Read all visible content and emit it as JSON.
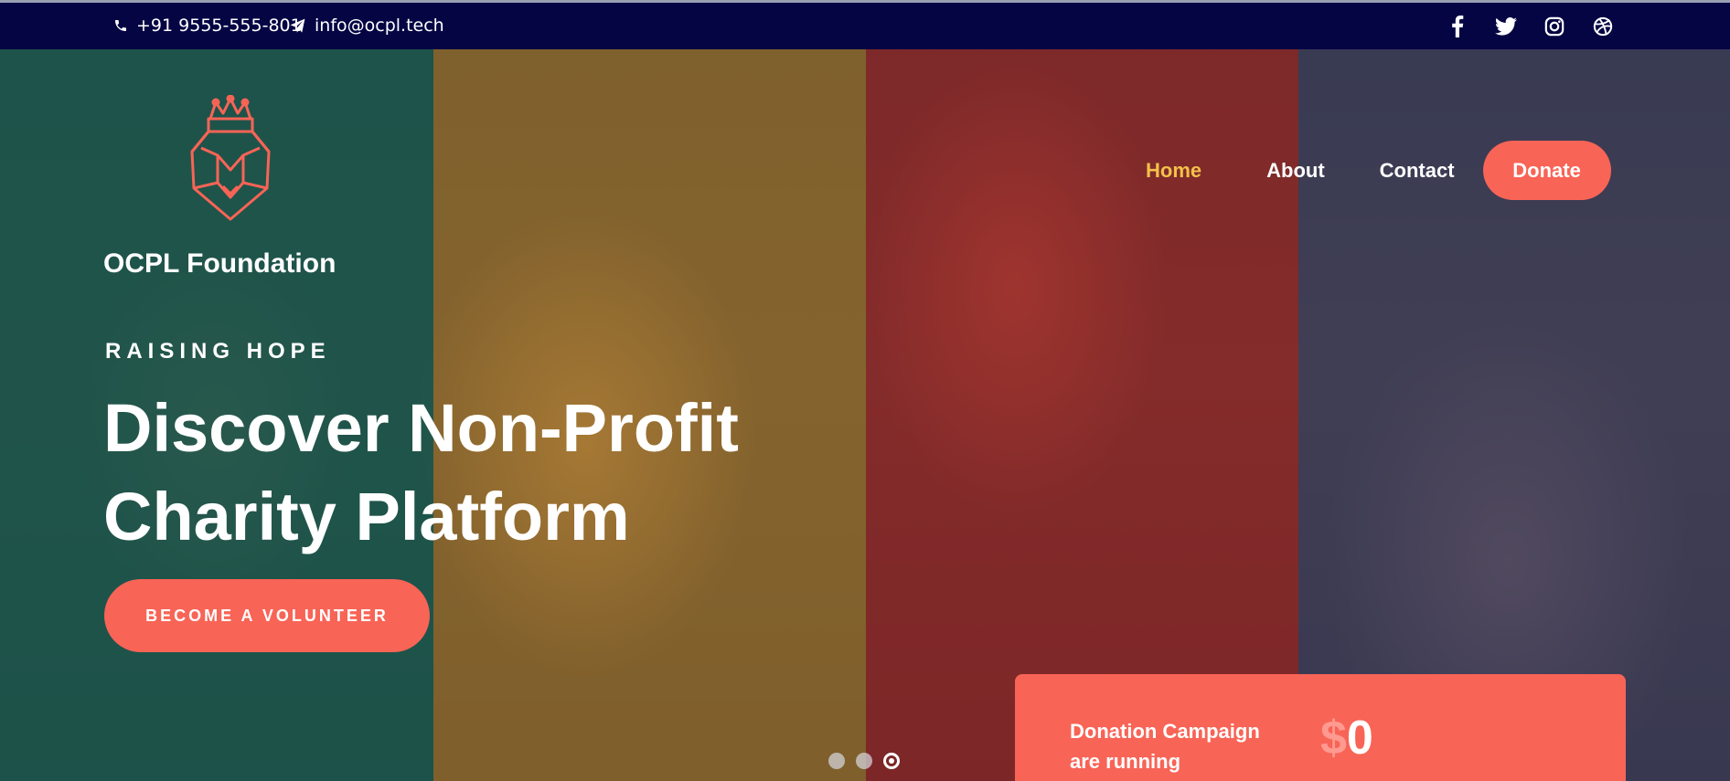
{
  "topbar": {
    "phone": "+91 9555-555-801",
    "email": "info@ocpl.tech",
    "socials": [
      "facebook-icon",
      "twitter-icon",
      "instagram-icon",
      "dribbble-icon"
    ]
  },
  "brand": {
    "name": "OCPL Foundation",
    "logo_icon": "crowned-lion-shield-icon",
    "logo_color": "#f86456"
  },
  "nav": {
    "items": [
      {
        "label": "Home",
        "active": true
      },
      {
        "label": "About",
        "active": false
      },
      {
        "label": "Contact",
        "active": false
      }
    ],
    "donate_label": "Donate"
  },
  "hero": {
    "eyebrow": "RAISING HOPE",
    "headline_line1": "Discover Non-Profit",
    "headline_line2": "Charity Platform",
    "cta_label": "BECOME A VOLUNTEER",
    "slides_total": 3,
    "slide_active": 3
  },
  "campaign": {
    "line1": "Donation Campaign",
    "line2": "are running",
    "currency": "$",
    "amount": "0"
  },
  "colors": {
    "topbar": "#050544",
    "accent": "#f86456",
    "nav_active": "#f3c14a",
    "strips": [
      "#145f55",
      "#aa8232",
      "#b4282d",
      "#374b7d"
    ]
  }
}
